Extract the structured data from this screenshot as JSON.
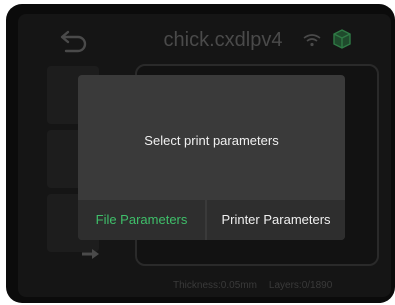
{
  "header": {
    "title": "chick.cxdlpv4",
    "back_icon": "return-arrow-icon",
    "wifi_icon": "wifi-icon",
    "status_icon": "box-icon"
  },
  "status_bar": {
    "thickness": "Thickness:0.05mm",
    "layers": "Layers:0/1890"
  },
  "dialog": {
    "message": "Select print parameters",
    "file_button": "File Parameters",
    "printer_button": "Printer Parameters"
  },
  "colors": {
    "accent": "#3fbf6a",
    "dialog_bg": "#3a3a3a",
    "screen_bg": "#151515"
  }
}
